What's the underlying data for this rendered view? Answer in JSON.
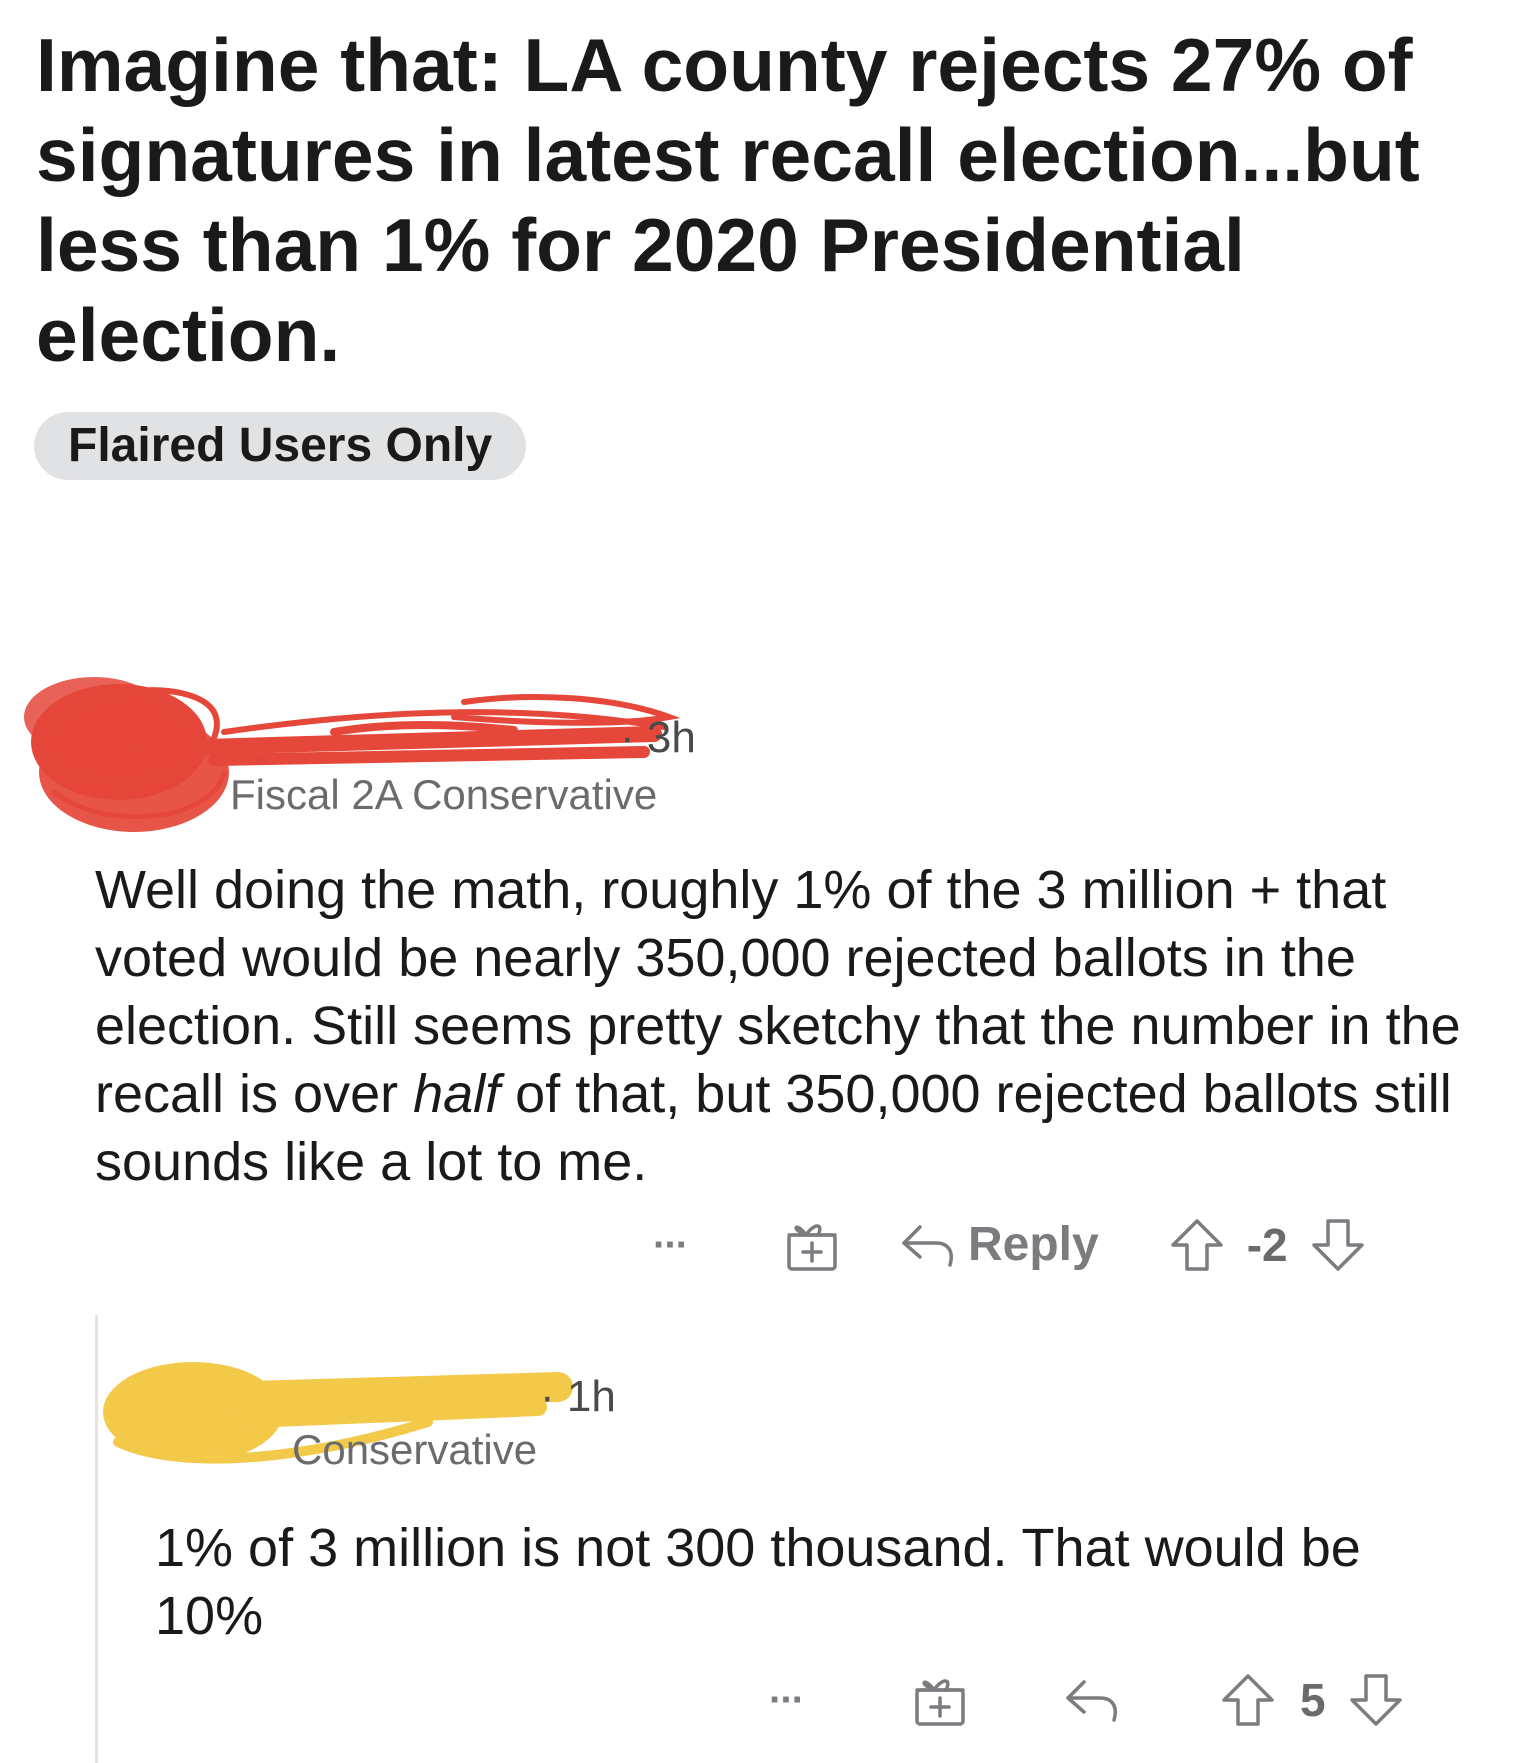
{
  "post": {
    "title": "Imagine that: LA county rejects 27% of signatures in latest recall election...but less than 1% for 2020 Presidential election.",
    "flair": "Flaired Users Only"
  },
  "comments": [
    {
      "time": "· 3h",
      "user_flair": "Fiscal 2A Conservative",
      "body_before_italic": "Well doing the math, roughly 1% of the 3 million + that voted would be nearly 350,000 rejected ballots in the election. Still seems pretty sketchy that the number in the recall is over ",
      "body_italic": "half",
      "body_after_italic": " of that, but 350,000 rejected ballots still sounds like a lot to me.",
      "more_label": "···",
      "reply_label": "Reply",
      "score": "-2",
      "redaction_color": "#e5473a"
    },
    {
      "time": "· 1h",
      "user_flair": "Conservative",
      "body": "1% of 3 million is not 300 thousand. That would be 10%",
      "more_label": "···",
      "score": "5",
      "redaction_color": "#f3c94a"
    }
  ],
  "icons": {
    "more": "more-horizontal-icon",
    "award": "gift-award-icon",
    "reply": "reply-arrow-icon",
    "upvote": "upvote-arrow-icon",
    "downvote": "downvote-arrow-icon"
  }
}
